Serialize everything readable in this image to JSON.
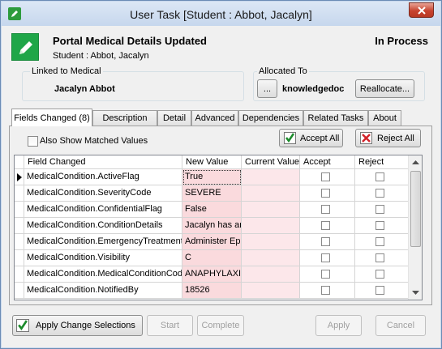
{
  "window": {
    "title": "User Task [Student : Abbot, Jacalyn]"
  },
  "header": {
    "title": "Portal Medical Details Updated",
    "subtitle": "Student : Abbot, Jacalyn",
    "status": "In Process"
  },
  "linked": {
    "label": "Linked to Medical",
    "name": "Jacalyn Abbot"
  },
  "allocated": {
    "label": "Allocated To",
    "browse_label": "...",
    "name": "knowledgedoc",
    "reallocate_label": "Reallocate..."
  },
  "tabs": [
    {
      "label": "Fields Changed (8)"
    },
    {
      "label": "Description"
    },
    {
      "label": "Detail"
    },
    {
      "label": "Advanced"
    },
    {
      "label": "Dependencies"
    },
    {
      "label": "Related Tasks"
    },
    {
      "label": "About"
    }
  ],
  "panel": {
    "show_matched_label": "Also Show Matched Values",
    "accept_all_label": "Accept All",
    "reject_all_label": "Reject All"
  },
  "grid": {
    "columns": [
      "Field Changed",
      "New Value",
      "Current Value",
      "Accept",
      "Reject"
    ],
    "rows": [
      {
        "field": "MedicalCondition.ActiveFlag",
        "new_value": "True",
        "current_value": ""
      },
      {
        "field": "MedicalCondition.SeverityCode",
        "new_value": "SEVERE",
        "current_value": ""
      },
      {
        "field": "MedicalCondition.ConfidentialFlag",
        "new_value": "False",
        "current_value": ""
      },
      {
        "field": "MedicalCondition.ConditionDetails",
        "new_value": "Jacalyn has an",
        "current_value": ""
      },
      {
        "field": "MedicalCondition.EmergencyTreatmentDetails",
        "new_value": "Administer Epil",
        "current_value": ""
      },
      {
        "field": "MedicalCondition.Visibility",
        "new_value": "C",
        "current_value": ""
      },
      {
        "field": "MedicalCondition.MedicalConditionCode",
        "new_value": "ANAPHYLAXIS",
        "current_value": ""
      },
      {
        "field": "MedicalCondition.NotifiedBy",
        "new_value": "18526",
        "current_value": ""
      }
    ]
  },
  "footer": {
    "apply_changes_label": "Apply Change Selections",
    "start_label": "Start",
    "complete_label": "Complete",
    "apply_label": "Apply",
    "cancel_label": "Cancel"
  },
  "colors": {
    "accent_green": "#1fa648",
    "new_value_bg": "#fadadd",
    "current_value_bg": "#fce7ea"
  }
}
